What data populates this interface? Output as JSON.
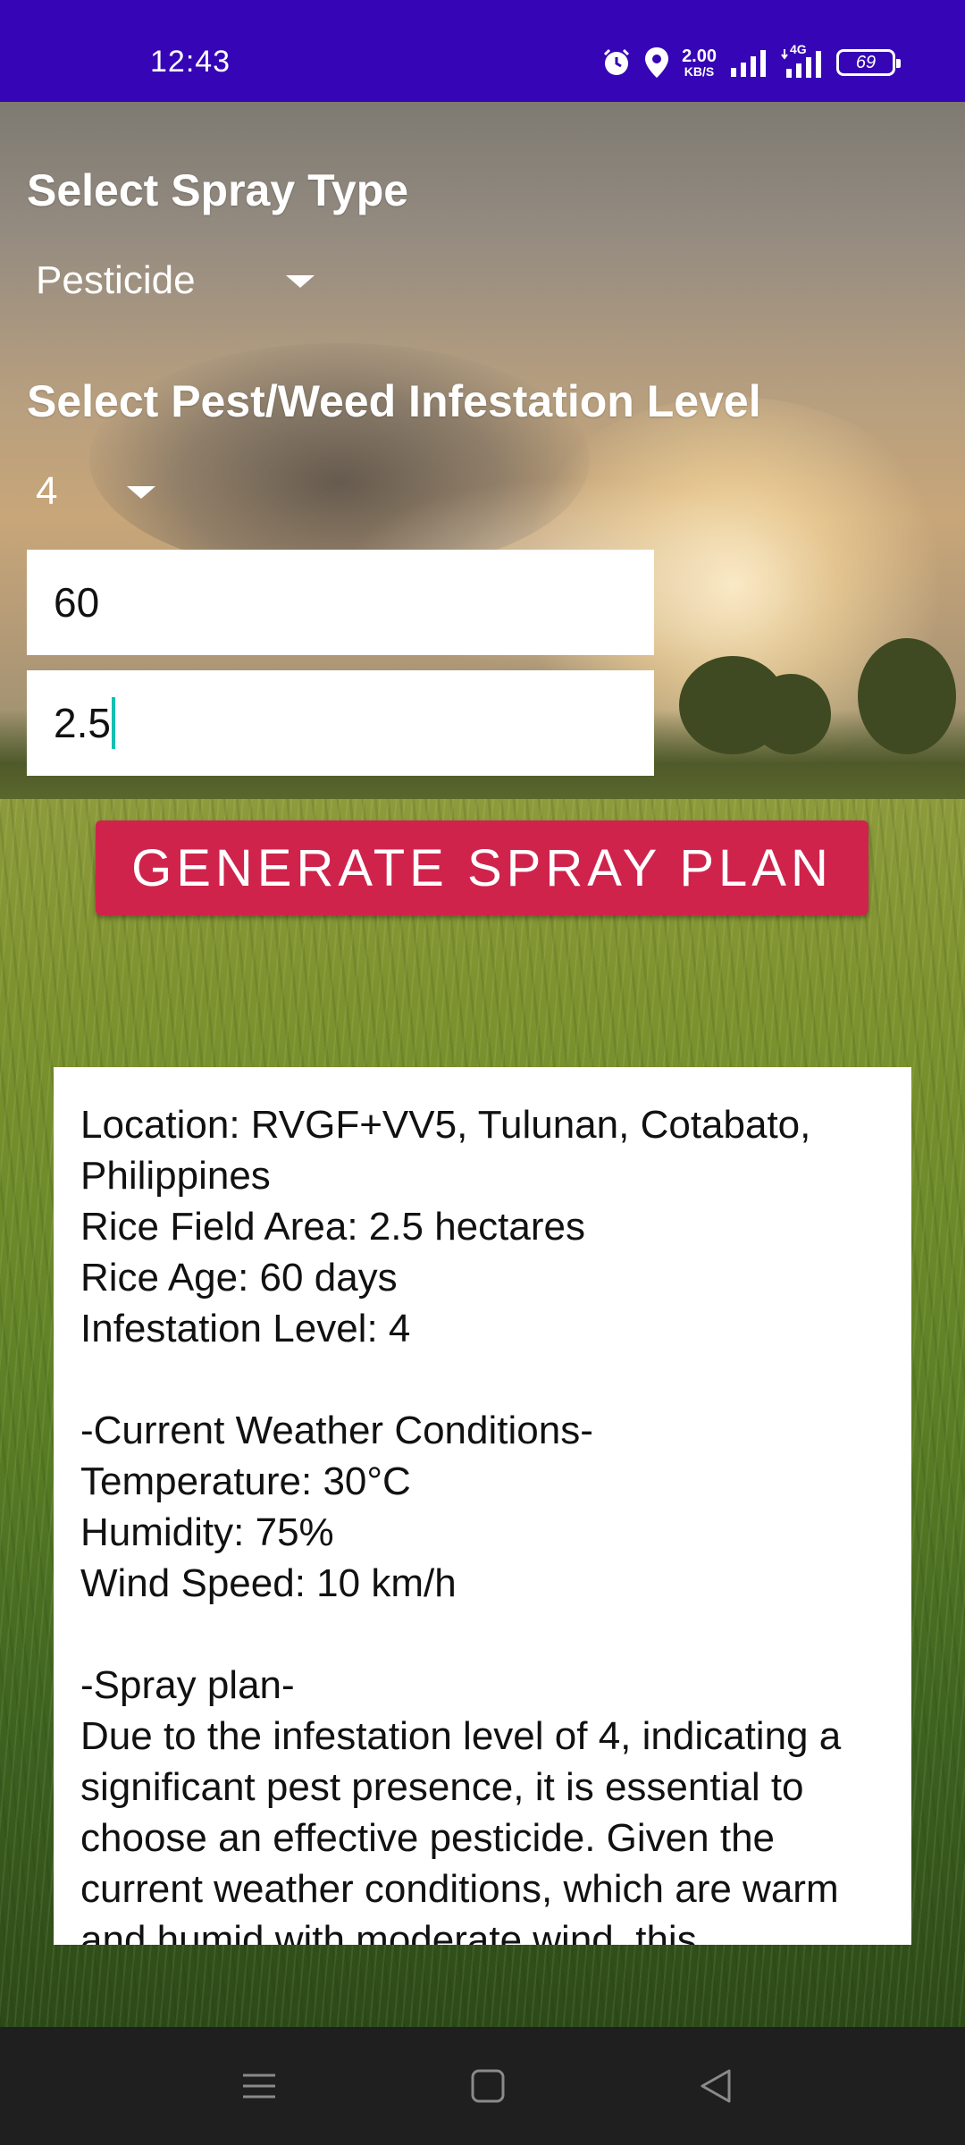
{
  "status_bar": {
    "time": "12:43",
    "net_speed_value": "2.00",
    "net_speed_unit": "KB/S",
    "network_type": "4G",
    "battery": "69",
    "icons": [
      "alarm-icon",
      "location-icon",
      "signal-icon",
      "signal-4g-icon",
      "battery-icon"
    ]
  },
  "form": {
    "spray_type_label": "Select Spray Type",
    "spray_type_selected": "Pesticide",
    "infestation_label": "Select Pest/Weed Infestation Level",
    "infestation_selected": "4",
    "rice_age_value": "60",
    "area_value": "2.5",
    "generate_button": "GENERATE SPRAY PLAN"
  },
  "result": {
    "location": "Location: RVGF+VV5, Tulunan, Cotabato, Philippines",
    "area": "Rice Field Area: 2.5 hectares",
    "age": "Rice Age: 60 days",
    "infestation": "Infestation Level: 4",
    "weather_heading": "-Current Weather Conditions-",
    "temperature": "Temperature: 30°C",
    "humidity": "Humidity: 75%",
    "wind": "Wind Speed: 10 km/h",
    "plan_heading": "-Spray plan-",
    "plan_text": "Due to the infestation level of 4, indicating a significant pest presence, it is essential to choose an effective pesticide. Given the current weather conditions, which are warm and humid with moderate wind, this"
  },
  "nav_bar": {
    "icons": [
      "menu-icon",
      "home-icon",
      "back-icon"
    ]
  },
  "colors": {
    "status_bar": "#3605b5",
    "button": "#cf234c",
    "cursor": "#14c0b0",
    "nav_bar": "#1f1f1f"
  }
}
